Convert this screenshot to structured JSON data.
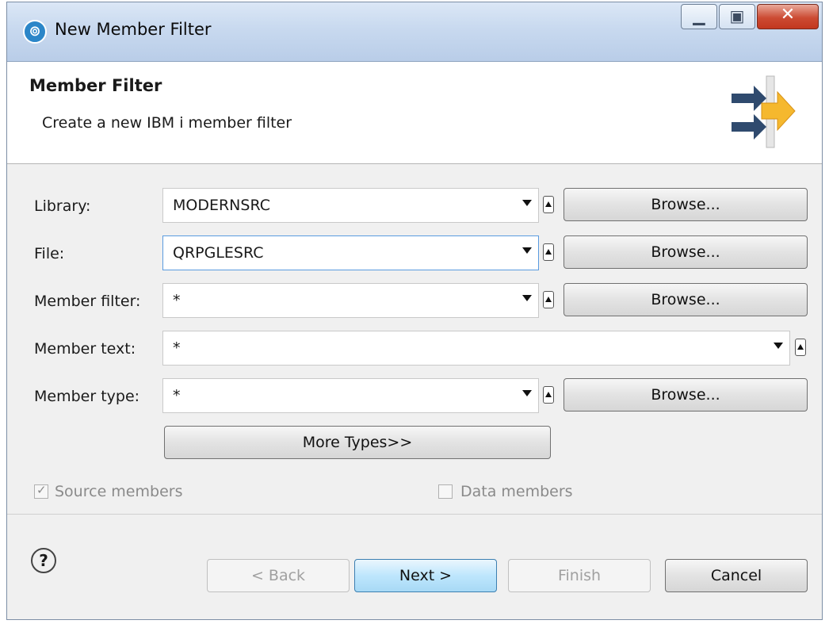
{
  "window": {
    "title": "New Member Filter"
  },
  "banner": {
    "title": "Member Filter",
    "subtitle": "Create a new IBM i member filter"
  },
  "fields": [
    {
      "label": "Library:",
      "value": "MODERNSRC"
    },
    {
      "label": "File:",
      "value": "QRPGLESRC"
    },
    {
      "label": "Member filter:",
      "value": "*"
    },
    {
      "label": "Member text:",
      "value": "*"
    },
    {
      "label": "Member type:",
      "value": "*"
    }
  ],
  "browse_label": "Browse...",
  "more_types_label": "More Types>>",
  "checkboxes": {
    "source": {
      "label": "Source members",
      "checked": true
    },
    "data": {
      "label": "Data members",
      "checked": false
    }
  },
  "footer": {
    "back": "< Back",
    "next": "Next >",
    "finish": "Finish",
    "cancel": "Cancel"
  },
  "icons": {
    "app": "eclipse-app-icon",
    "help": "help-icon",
    "banner": "filter-wizard-icon"
  }
}
